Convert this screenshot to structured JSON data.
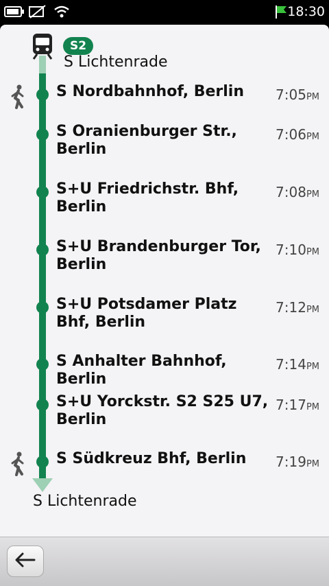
{
  "status": {
    "time": "18:30",
    "icons": [
      "battery-icon",
      "no-sim-icon",
      "wifi-icon",
      "green-flag-icon"
    ]
  },
  "route": {
    "line_badge": "S2",
    "origin": "S Lichtenrade",
    "destination": "S Lichtenrade",
    "line_color": "#12834f",
    "stops": [
      {
        "name": "S Nordbahnhof, Berlin",
        "time": "7:05",
        "ampm": "PM",
        "walk": true
      },
      {
        "name": "S Oranienburger Str., Berlin",
        "time": "7:06",
        "ampm": "PM",
        "walk": false
      },
      {
        "name": "S+U Friedrichstr. Bhf, Berlin",
        "time": "7:08",
        "ampm": "PM",
        "walk": false
      },
      {
        "name": "S+U Brandenburger Tor, Berlin",
        "time": "7:10",
        "ampm": "PM",
        "walk": false
      },
      {
        "name": "S+U Potsdamer Platz Bhf, Berlin",
        "time": "7:12",
        "ampm": "PM",
        "walk": false
      },
      {
        "name": "S Anhalter Bahnhof, Berlin",
        "time": "7:14",
        "ampm": "PM",
        "walk": false
      },
      {
        "name": "S+U Yorckstr. S2 S25 U7, Berlin",
        "time": "7:17",
        "ampm": "PM",
        "walk": false
      },
      {
        "name": "S Südkreuz Bhf, Berlin",
        "time": "7:19",
        "ampm": "PM",
        "walk": true
      }
    ]
  },
  "toolbar": {
    "back_icon": "back-arrow-icon"
  }
}
